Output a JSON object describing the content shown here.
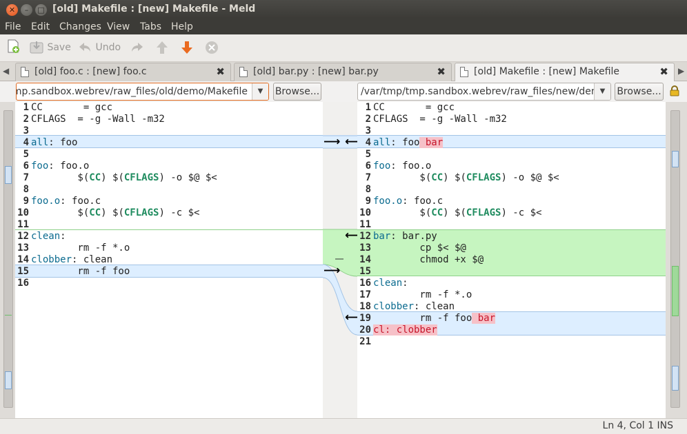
{
  "window": {
    "title": "[old] Makefile : [new] Makefile - Meld"
  },
  "menu": [
    "File",
    "Edit",
    "Changes",
    "View",
    "Tabs",
    "Help"
  ],
  "toolbar": {
    "save_label": "Save",
    "undo_label": "Undo"
  },
  "tabs": [
    {
      "label": "[old] foo.c : [new] foo.c",
      "active": false
    },
    {
      "label": "[old] bar.py : [new] bar.py",
      "active": false
    },
    {
      "label": "[old] Makefile : [new] Makefile",
      "active": true
    }
  ],
  "paths": {
    "left": "/var/tmp/tmp.sandbox.webrev/raw_files/old/demo/Makefile",
    "right": "/var/tmp/tmp.sandbox.webrev/raw_files/new/demo/Makefile",
    "browse_label": "Browse..."
  },
  "left_lines": [
    {
      "n": "1",
      "t": "CC       = gcc"
    },
    {
      "n": "2",
      "t": "CFLAGS  = -g -Wall -m32"
    },
    {
      "n": "3",
      "t": ""
    },
    {
      "n": "4",
      "t": "all: foo"
    },
    {
      "n": "5",
      "t": ""
    },
    {
      "n": "6",
      "t": "foo: foo.o"
    },
    {
      "n": "7",
      "t": "        $(CC) $(CFLAGS) -o $@ $<"
    },
    {
      "n": "8",
      "t": ""
    },
    {
      "n": "9",
      "t": "foo.o: foo.c"
    },
    {
      "n": "10",
      "t": "        $(CC) $(CFLAGS) -c $<"
    },
    {
      "n": "11",
      "t": ""
    },
    {
      "n": "12",
      "t": "clean:"
    },
    {
      "n": "13",
      "t": "        rm -f *.o"
    },
    {
      "n": "14",
      "t": "clobber: clean"
    },
    {
      "n": "15",
      "t": "        rm -f foo"
    },
    {
      "n": "16",
      "t": ""
    }
  ],
  "right_lines": [
    {
      "n": "1",
      "t": "CC       = gcc"
    },
    {
      "n": "2",
      "t": "CFLAGS  = -g -Wall -m32"
    },
    {
      "n": "3",
      "t": ""
    },
    {
      "n": "4",
      "t": "all: foo bar"
    },
    {
      "n": "5",
      "t": ""
    },
    {
      "n": "6",
      "t": "foo: foo.o"
    },
    {
      "n": "7",
      "t": "        $(CC) $(CFLAGS) -o $@ $<"
    },
    {
      "n": "8",
      "t": ""
    },
    {
      "n": "9",
      "t": "foo.o: foo.c"
    },
    {
      "n": "10",
      "t": "        $(CC) $(CFLAGS) -c $<"
    },
    {
      "n": "11",
      "t": ""
    },
    {
      "n": "12",
      "t": "bar: bar.py"
    },
    {
      "n": "13",
      "t": "        cp $< $@"
    },
    {
      "n": "14",
      "t": "        chmod +x $@"
    },
    {
      "n": "15",
      "t": ""
    },
    {
      "n": "16",
      "t": "clean:"
    },
    {
      "n": "17",
      "t": "        rm -f *.o"
    },
    {
      "n": "18",
      "t": "clobber: clean"
    },
    {
      "n": "19",
      "t": "        rm -f foo bar"
    },
    {
      "n": "20",
      "t": "cl: clobber"
    },
    {
      "n": "21",
      "t": ""
    }
  ],
  "status": {
    "text": "Ln 4, Col 1  INS"
  },
  "colors": {
    "change": "#ddeeff",
    "insert": "#c6f5c0",
    "inline_diff": "#f6c1c8",
    "title_bg": "#3c3b37"
  }
}
